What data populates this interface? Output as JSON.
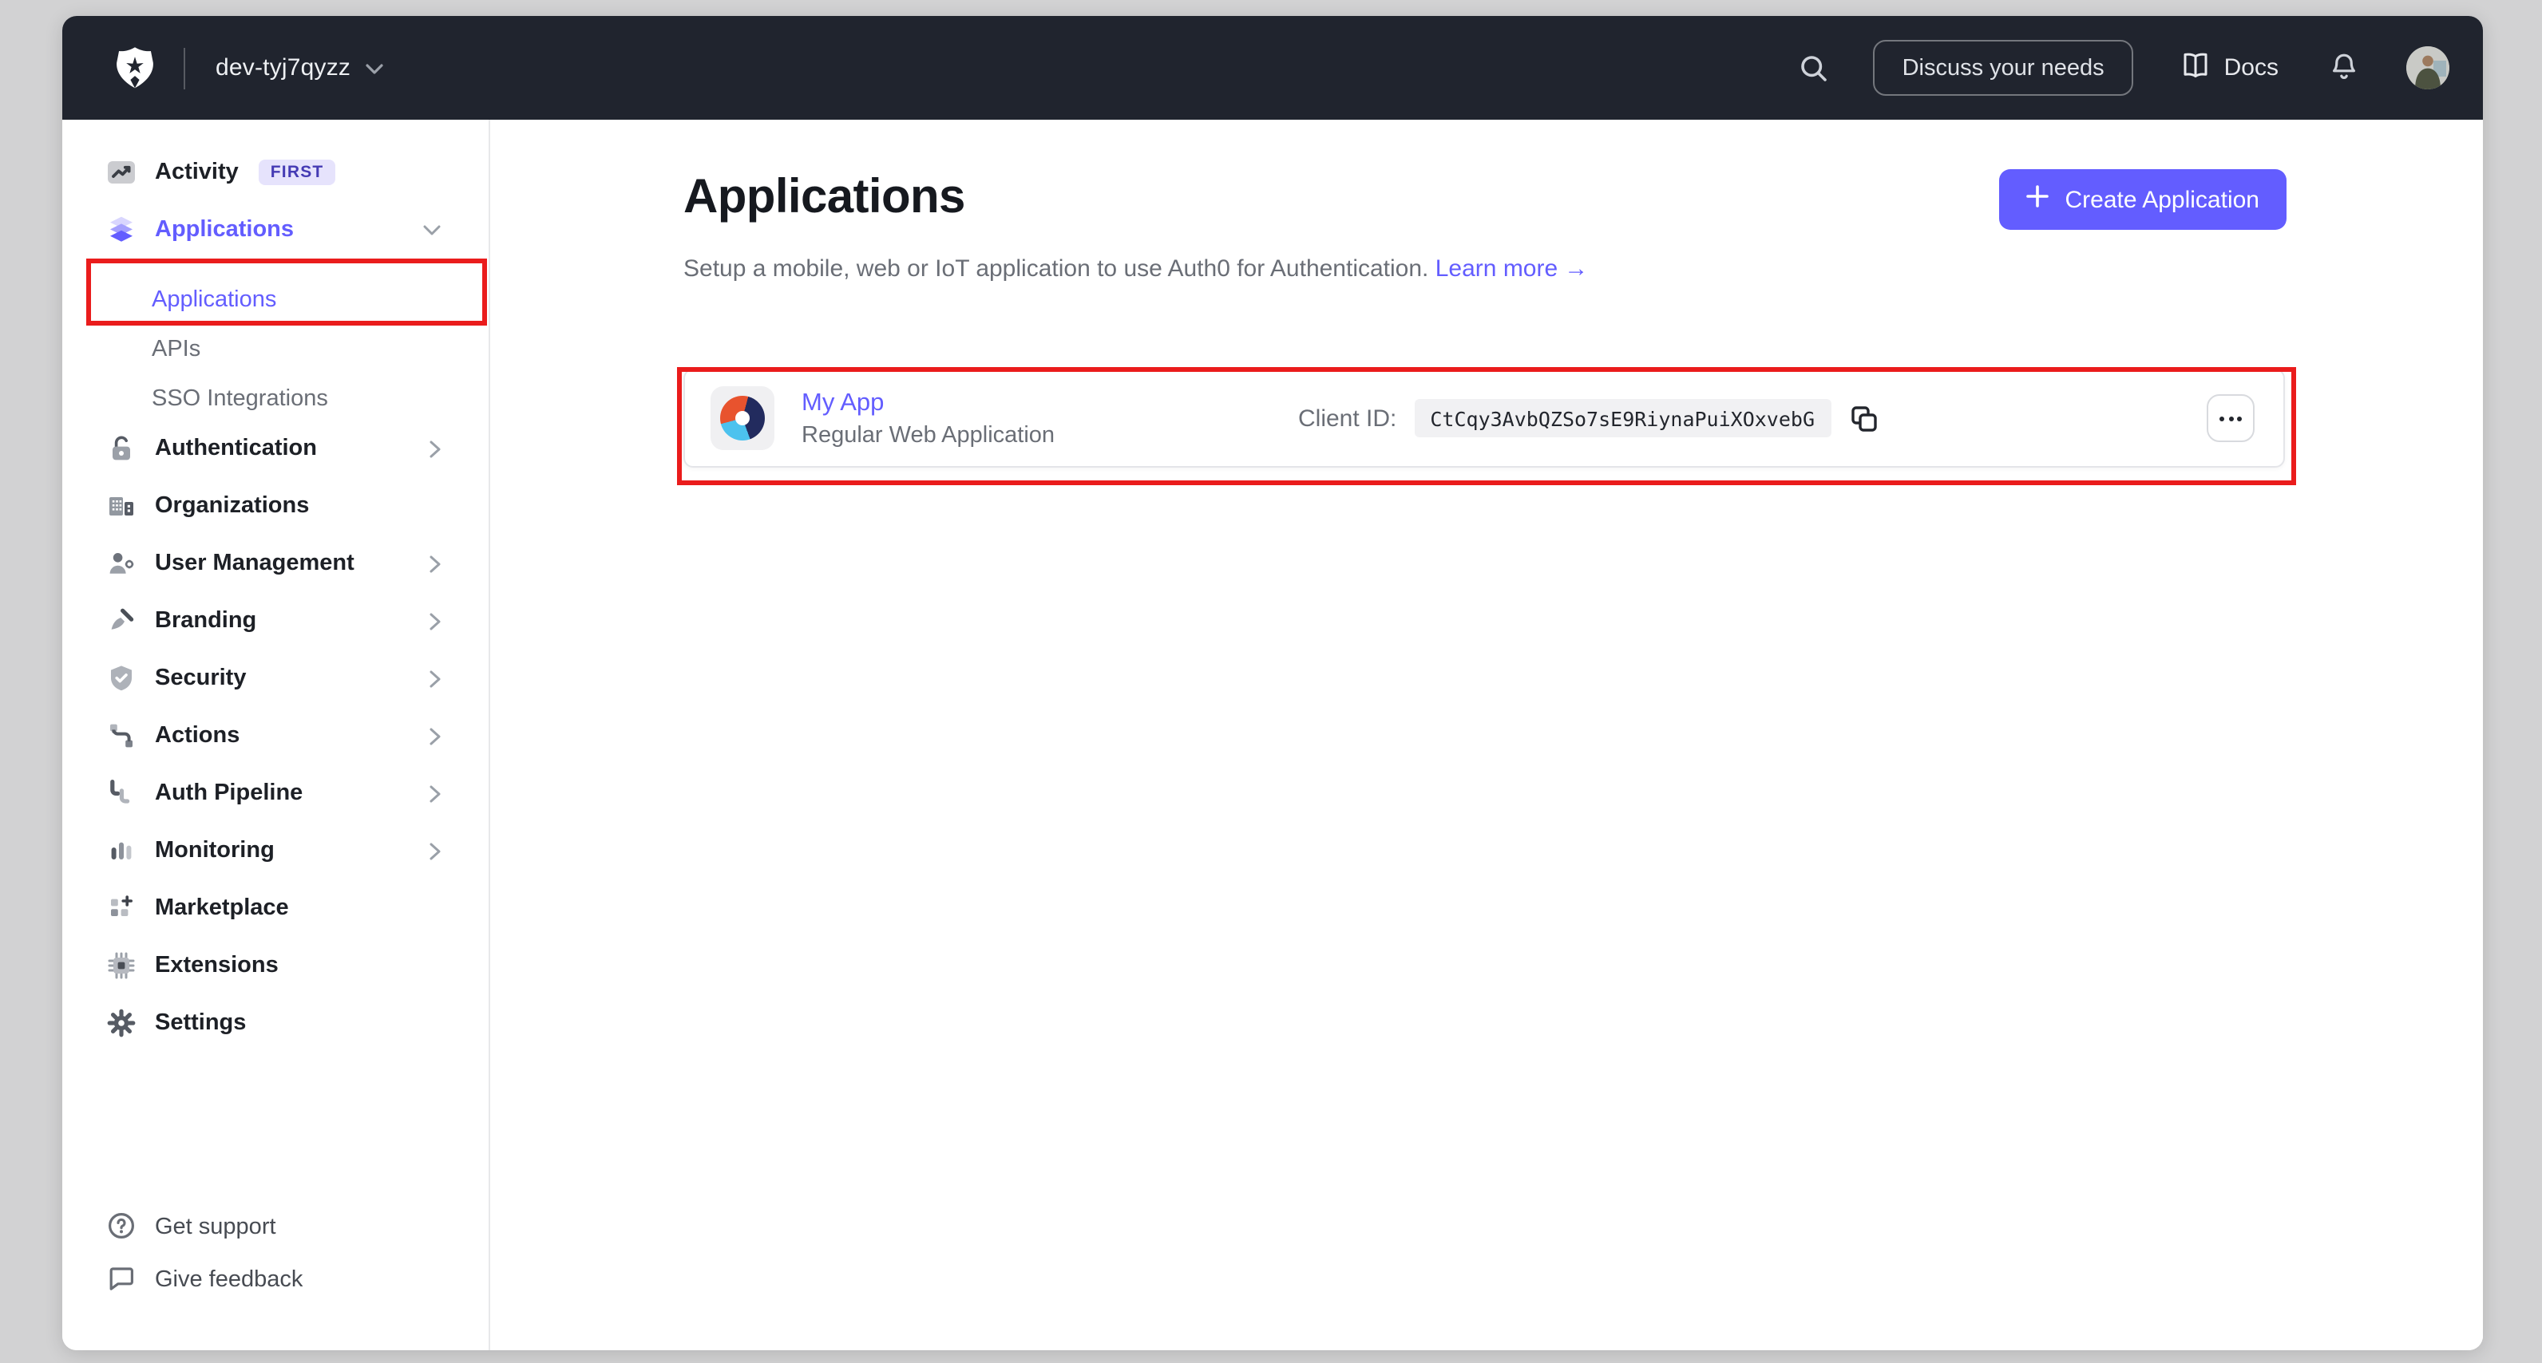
{
  "topbar": {
    "tenant": "dev-tyj7qyzz",
    "discuss_label": "Discuss your needs",
    "docs_label": "Docs",
    "bg_color": "#20242e",
    "icons": [
      "auth0-shield-logo",
      "chevron-down-icon",
      "search-icon",
      "book-icon",
      "bell-icon",
      "avatar"
    ]
  },
  "sidebar": {
    "items": [
      {
        "label": "Activity",
        "icon": "activity-chart-icon",
        "badge": "FIRST"
      },
      {
        "label": "Applications",
        "icon": "applications-stack-icon",
        "state": "expanded",
        "active": true,
        "children": [
          {
            "label": "Applications",
            "active": true
          },
          {
            "label": "APIs"
          },
          {
            "label": "SSO Integrations"
          }
        ]
      },
      {
        "label": "Authentication",
        "icon": "lock-icon",
        "chevron": "right"
      },
      {
        "label": "Organizations",
        "icon": "organization-building-icon"
      },
      {
        "label": "User Management",
        "icon": "user-gear-icon",
        "chevron": "right"
      },
      {
        "label": "Branding",
        "icon": "paintbrush-icon",
        "chevron": "right"
      },
      {
        "label": "Security",
        "icon": "shield-check-icon",
        "chevron": "right"
      },
      {
        "label": "Actions",
        "icon": "flow-icon",
        "chevron": "right"
      },
      {
        "label": "Auth Pipeline",
        "icon": "pipeline-icon",
        "chevron": "right"
      },
      {
        "label": "Monitoring",
        "icon": "bar-chart-icon",
        "chevron": "right"
      },
      {
        "label": "Marketplace",
        "icon": "marketplace-grid-icon"
      },
      {
        "label": "Extensions",
        "icon": "chip-icon"
      },
      {
        "label": "Settings",
        "icon": "gear-icon"
      }
    ],
    "footer": [
      {
        "label": "Get support",
        "icon": "help-circle-icon"
      },
      {
        "label": "Give feedback",
        "icon": "feedback-bubble-icon"
      }
    ]
  },
  "main": {
    "title": "Applications",
    "subtitle": "Setup a mobile, web or IoT application to use Auth0 for Authentication.",
    "learn_more": "Learn more",
    "learn_more_arrow": "→",
    "create_button": "Create Application",
    "app_row": {
      "name": "My App",
      "type": "Regular Web Application",
      "client_id_label": "Client ID:",
      "client_id": "CtCqy3AvbQZSo7sE9RiynaPuiXOxvebG",
      "icons": [
        "app-logo",
        "copy-icon",
        "meatball-menu-icon"
      ]
    }
  },
  "annotations": {
    "color": "#ea1c1c",
    "boxes": [
      "sidebar-applications-subitem",
      "my-app-row"
    ]
  },
  "colors": {
    "accent_indigo": "#635dff",
    "topbar_bg": "#20242e",
    "page_frame": "#d2d2d3",
    "logo_orange": "#e8532e",
    "logo_navy": "#222b5e",
    "logo_blue": "#4cc2ee"
  }
}
